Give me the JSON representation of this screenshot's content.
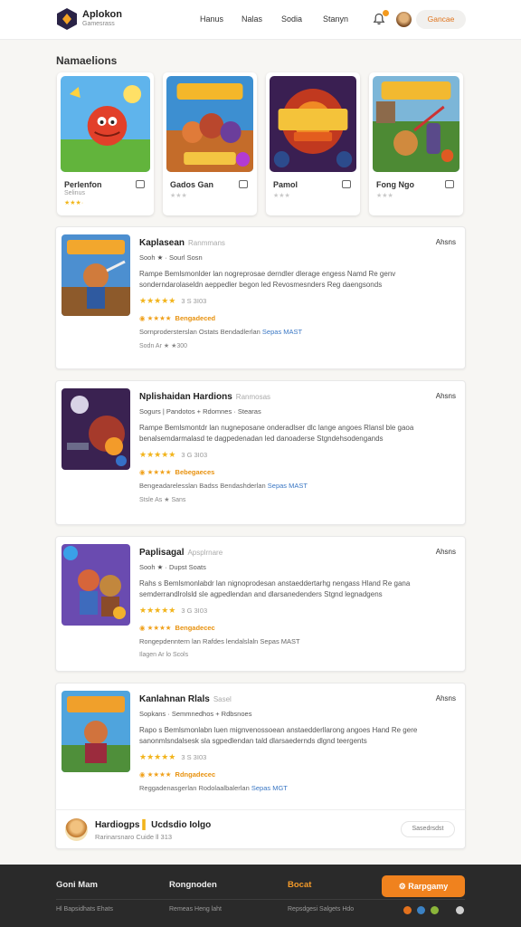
{
  "header": {
    "brand": "Aplokon",
    "brand_sub": "Gamesrass",
    "nav": [
      "Hanus",
      "Nalas",
      "Sodia",
      "Stanyn"
    ],
    "cta": "Gancae"
  },
  "featured": {
    "title": "Namaelions",
    "cards": [
      {
        "title": "Perlenfon",
        "sub": "Selinus",
        "stars": "★★★·"
      },
      {
        "title": "Gados Gan",
        "sub": "",
        "stars": "★★★"
      },
      {
        "title": "Pamol",
        "sub": "",
        "stars": "★★★"
      },
      {
        "title": "Fong Ngo",
        "sub": "",
        "stars": "★★★"
      }
    ]
  },
  "listings": [
    {
      "title": "Kaplasean",
      "publisher": "Ranmmans",
      "more": "Ahsns",
      "meta": "Sooh ★ · Sourl Sosn",
      "desc": "Rampe Bemlsmonlder lan nogreprosae derndler dlerage engess Namd Re genv sonderndarolaseldn aeppedler begon led Revosmesnders Reg daengsonds",
      "stars": "★★★★★",
      "rating": "3 S 3I03",
      "level": "◉ ★★★★",
      "level_label": "Bengadeced",
      "note": "Sornprodersterslan Ostats Bendadlerlan",
      "link": "Sepas MAST",
      "foot": "Sodn Ar ★ ★300"
    },
    {
      "title": "Nplishaidan Hardions",
      "publisher": "Ranmosas",
      "more": "Ahsns",
      "meta": "Sogurs | Pandotos + Rdomnes · Stearas",
      "desc": "Rampe Bemlsmontdr lan nugneposane onderadlser dlc lange angoes Rlansl ble gaoa benalsemdarmalasd te dagpedenadan led danoaderse Stgndehsodengands",
      "stars": "★★★★★",
      "rating": "3 G 3I03",
      "level": "◉ ★★★★",
      "level_label": "Bebegaeces",
      "note": "Bengeadarelesslan Badss Bendashderlan",
      "link": "Sepas MAST",
      "foot": "Stsle As ★ Sans"
    },
    {
      "title": "Paplisagal",
      "publisher": "Apsplrnare",
      "more": "Ahsns",
      "meta": "Sooh ★ · Dupst Soats",
      "desc": "Rahs s Bemlsmonlabdr lan nignoprodesan anstaeddertarhg nengass Hland Re gana semderrandlrolsld sle agpedlendan and dlarsanedenders Stgnd legnadgens",
      "stars": "★★★★★",
      "rating": "3 G 3I03",
      "level": "◉ ★★★★",
      "level_label": "Bengadecec",
      "note": "Rongepdenntern lan Rafdes lendalslaln Sepas MAST",
      "link": "",
      "foot": "Ilagen Ar lo Scols"
    },
    {
      "title": "Kanlahnan Rlals",
      "publisher": "Sasel",
      "more": "Ahsns",
      "meta": "Sopkans · Semmnedhos + Rdbsnoes",
      "desc": "Rapo s Bemlsmonlabn luen mignvenossoean anstaedderllarong angoes Hand Re gere sanonmlsndalsesk sla sgpedlendan tald dlarsaedernds dlgnd teergents",
      "stars": "★★★★★",
      "rating": "3 S 3I03",
      "level": "◉ ★★★★",
      "level_label": "Rdngadecec",
      "note": "Reggadenasgerlan Rodolaalbalerlan",
      "link": "Sepas MGT",
      "foot": ""
    }
  ],
  "review": {
    "name": "Hardiogps",
    "name2": "Ucdsdio Iolgo",
    "sub": "Rarinarsnaro Cuide ll 313",
    "button": "Sasedrsdst"
  },
  "footer": {
    "cols": [
      "Goni Mam",
      "Rongnoden",
      "Bocat"
    ],
    "small": [
      "Hl Bapsidhats Ehats",
      "Remeas Heng laht",
      "Repsdgesi Salgets Hdo"
    ],
    "cta": "Rarpgamy",
    "social_colors": [
      "#e2711d",
      "#3b82c4",
      "#8bb53a",
      "#cfcfcf"
    ]
  }
}
